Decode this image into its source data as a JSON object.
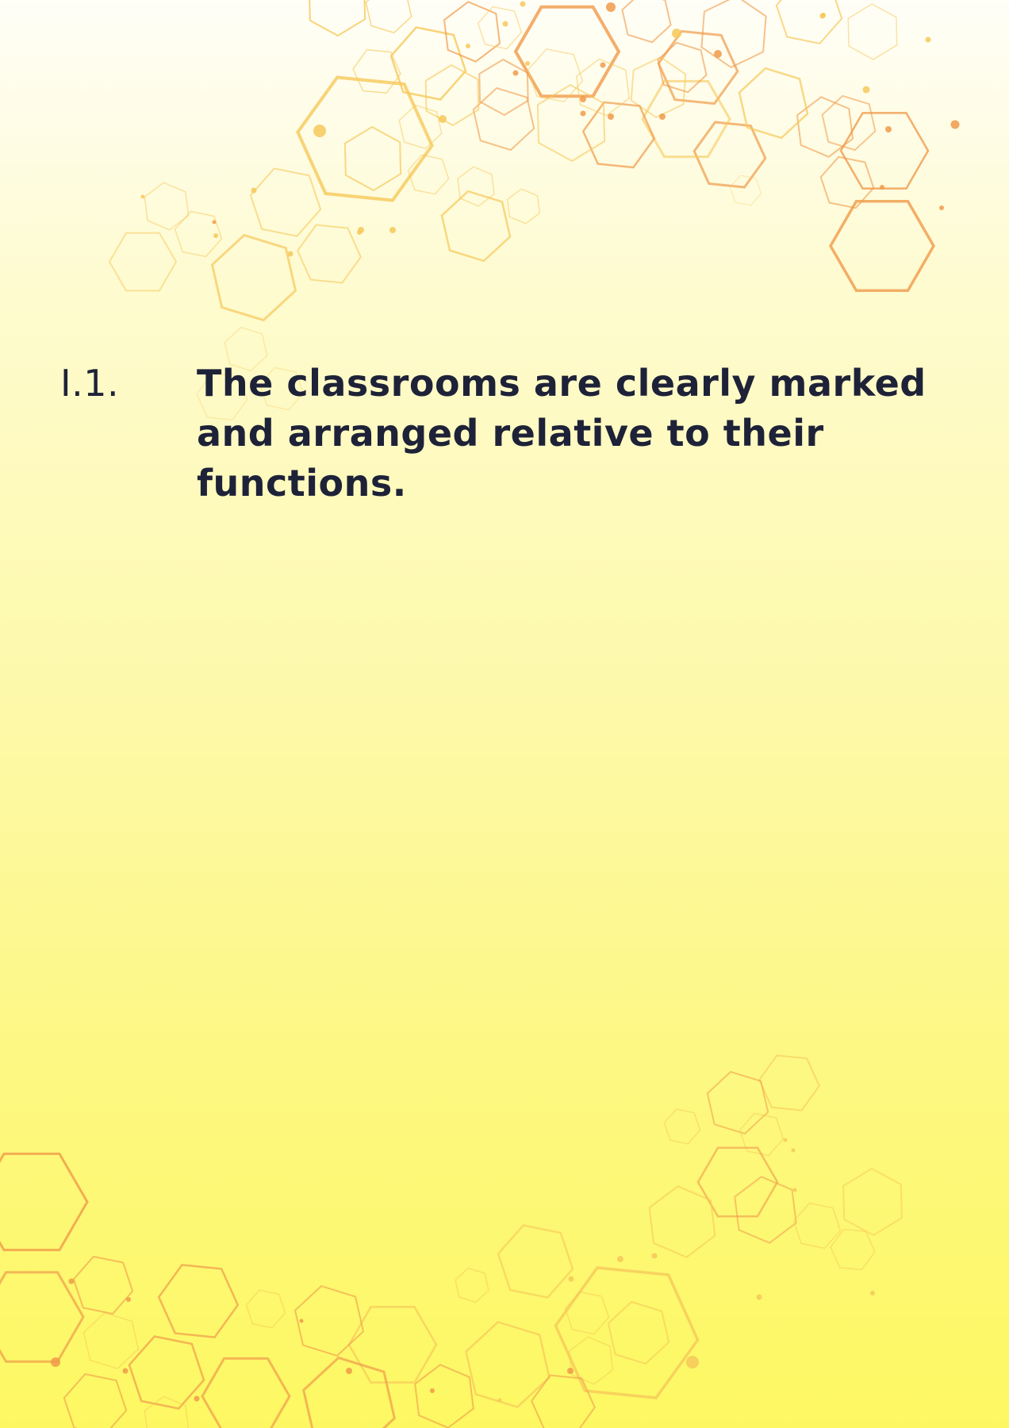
{
  "document": {
    "item_number": "I.1.",
    "item_text": "The classrooms are clearly marked and arranged relative to their functions."
  },
  "colors": {
    "text": "#1e2238",
    "hex_light": "#f6c85a",
    "hex_dark": "#f09a4a",
    "background_top": "#fffef7",
    "background_bottom": "#fdf862"
  },
  "decorations": {
    "top_pattern": "hexagon-network",
    "bottom_pattern": "hexagon-network"
  }
}
